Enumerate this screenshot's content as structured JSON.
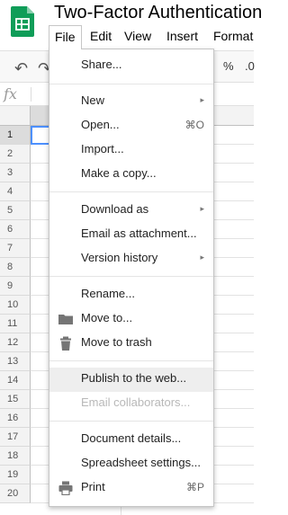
{
  "app": {
    "doc_title": "Two-Factor Authentication",
    "menubar": [
      "File",
      "Edit",
      "View",
      "Insert",
      "Format"
    ],
    "toolbar": {
      "undo_icon": "undo-icon",
      "redo_icon": "redo-icon",
      "percent": "%",
      "decimal": ".0"
    },
    "formula_bar": {
      "fx": "fx"
    },
    "rows": [
      "1",
      "2",
      "3",
      "4",
      "5",
      "6",
      "7",
      "8",
      "9",
      "10",
      "11",
      "12",
      "13",
      "14",
      "15",
      "16",
      "17",
      "18",
      "19",
      "20"
    ]
  },
  "file_menu": {
    "items": [
      {
        "label": "Share..."
      },
      {
        "label": "New",
        "submenu": "▸"
      },
      {
        "label": "Open...",
        "shortcut": "⌘O"
      },
      {
        "label": "Import..."
      },
      {
        "label": "Make a copy..."
      },
      {
        "label": "Download as",
        "submenu": "▸"
      },
      {
        "label": "Email as attachment..."
      },
      {
        "label": "Version history",
        "submenu": "▸"
      },
      {
        "label": "Rename..."
      },
      {
        "label": "Move to...",
        "icon": "folder-icon"
      },
      {
        "label": "Move to trash",
        "icon": "trash-icon"
      },
      {
        "label": "Publish to the web..."
      },
      {
        "label": "Email collaborators..."
      },
      {
        "label": "Document details..."
      },
      {
        "label": "Spreadsheet settings..."
      },
      {
        "label": "Print",
        "shortcut": "⌘P",
        "icon": "print-icon"
      }
    ]
  },
  "colors": {
    "sheets_green": "#0f9d58",
    "selection_blue": "#4d90fe"
  }
}
